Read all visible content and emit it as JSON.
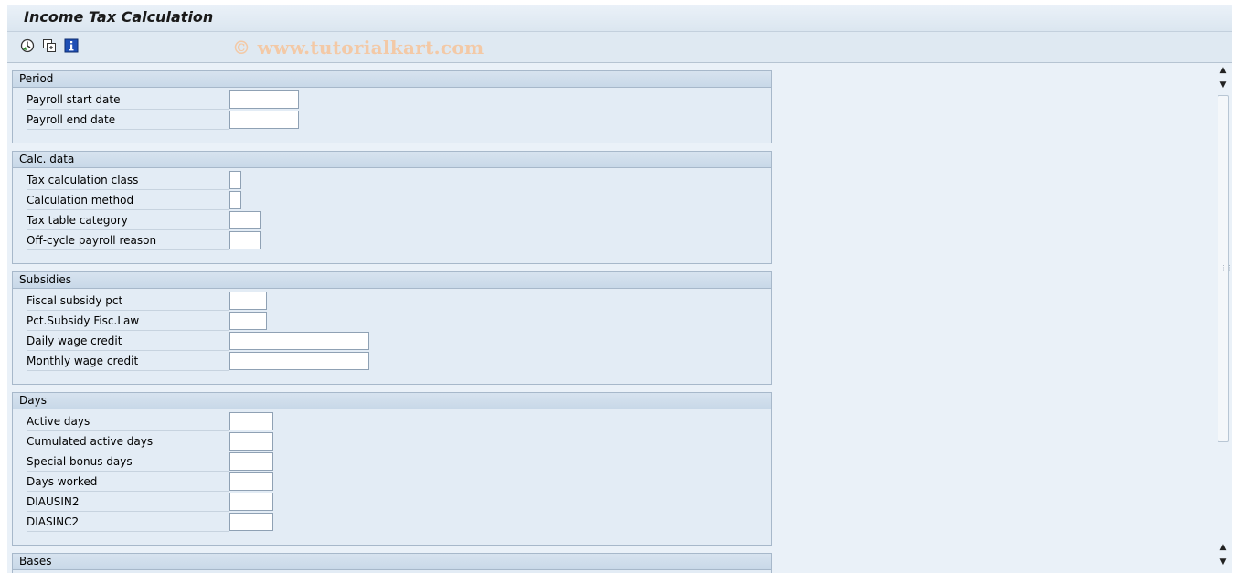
{
  "title": "Income Tax Calculation",
  "watermark": "© www.tutorialkart.com",
  "toolbar": {
    "buttons": [
      {
        "icon": "execute-icon"
      },
      {
        "icon": "copy-icon"
      },
      {
        "icon": "info-icon"
      }
    ]
  },
  "groups": {
    "period": {
      "title": "Period",
      "rows": [
        {
          "label": "Payroll start date",
          "value": ""
        },
        {
          "label": "Payroll end date",
          "value": ""
        }
      ]
    },
    "calc": {
      "title": "Calc. data",
      "rows": [
        {
          "label": "Tax calculation class",
          "value": ""
        },
        {
          "label": "Calculation method",
          "value": ""
        },
        {
          "label": "Tax table category",
          "value": ""
        },
        {
          "label": "Off-cycle payroll reason",
          "value": ""
        }
      ]
    },
    "subsidies": {
      "title": "Subsidies",
      "rows": [
        {
          "label": "Fiscal subsidy pct",
          "value": ""
        },
        {
          "label": "Pct.Subsidy Fisc.Law",
          "value": ""
        },
        {
          "label": "Daily wage credit",
          "value": ""
        },
        {
          "label": "Monthly wage credit",
          "value": ""
        }
      ]
    },
    "days": {
      "title": "Days",
      "rows": [
        {
          "label": "Active days",
          "value": ""
        },
        {
          "label": "Cumulated active days",
          "value": ""
        },
        {
          "label": "Special bonus days",
          "value": ""
        },
        {
          "label": "Days worked",
          "value": ""
        },
        {
          "label": "DIAUSIN2",
          "value": ""
        },
        {
          "label": "DIASINC2",
          "value": ""
        }
      ]
    },
    "bases": {
      "title": "Bases"
    }
  },
  "colors": {
    "background": "#eaf1f8",
    "group_header": "#c8d8e8",
    "border": "#a7b8ca",
    "watermark": "#f3c9a6"
  }
}
